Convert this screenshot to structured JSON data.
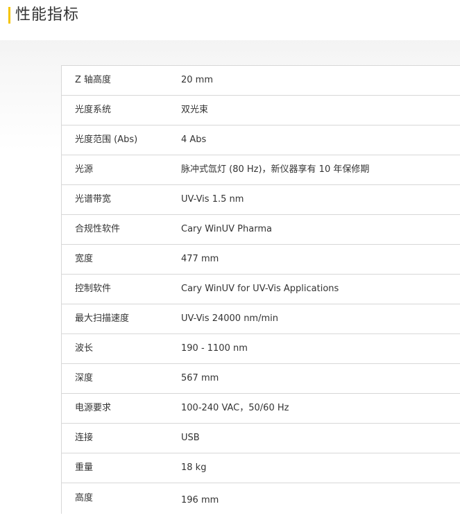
{
  "header": {
    "title": "性能指标",
    "accent_color": "#f5c400"
  },
  "specs": [
    {
      "label": "Z 轴高度",
      "value": "20 mm"
    },
    {
      "label": "光度系统",
      "value": "双光束"
    },
    {
      "label": "光度范围 (Abs)",
      "value": "4 Abs"
    },
    {
      "label": "光源",
      "value": "脉冲式氙灯 (80 Hz)，新仪器享有 10 年保修期"
    },
    {
      "label": "光谱带宽",
      "value": "UV-Vis 1.5 nm"
    },
    {
      "label": "合规性软件",
      "value": "Cary WinUV Pharma"
    },
    {
      "label": "宽度",
      "value": "477 mm"
    },
    {
      "label": "控制软件",
      "value": "Cary WinUV for UV-Vis Applications"
    },
    {
      "label": "最大扫描速度",
      "value": "UV-Vis 24000 nm/min"
    },
    {
      "label": "波长",
      "value": "190 - 1100 nm"
    },
    {
      "label": "深度",
      "value": "567 mm"
    },
    {
      "label": "电源要求",
      "value": "100-240 VAC，50/60 Hz"
    },
    {
      "label": "连接",
      "value": "USB"
    },
    {
      "label": "重量",
      "value": "18 kg"
    },
    {
      "label": "高度",
      "value": "196 mm"
    }
  ]
}
